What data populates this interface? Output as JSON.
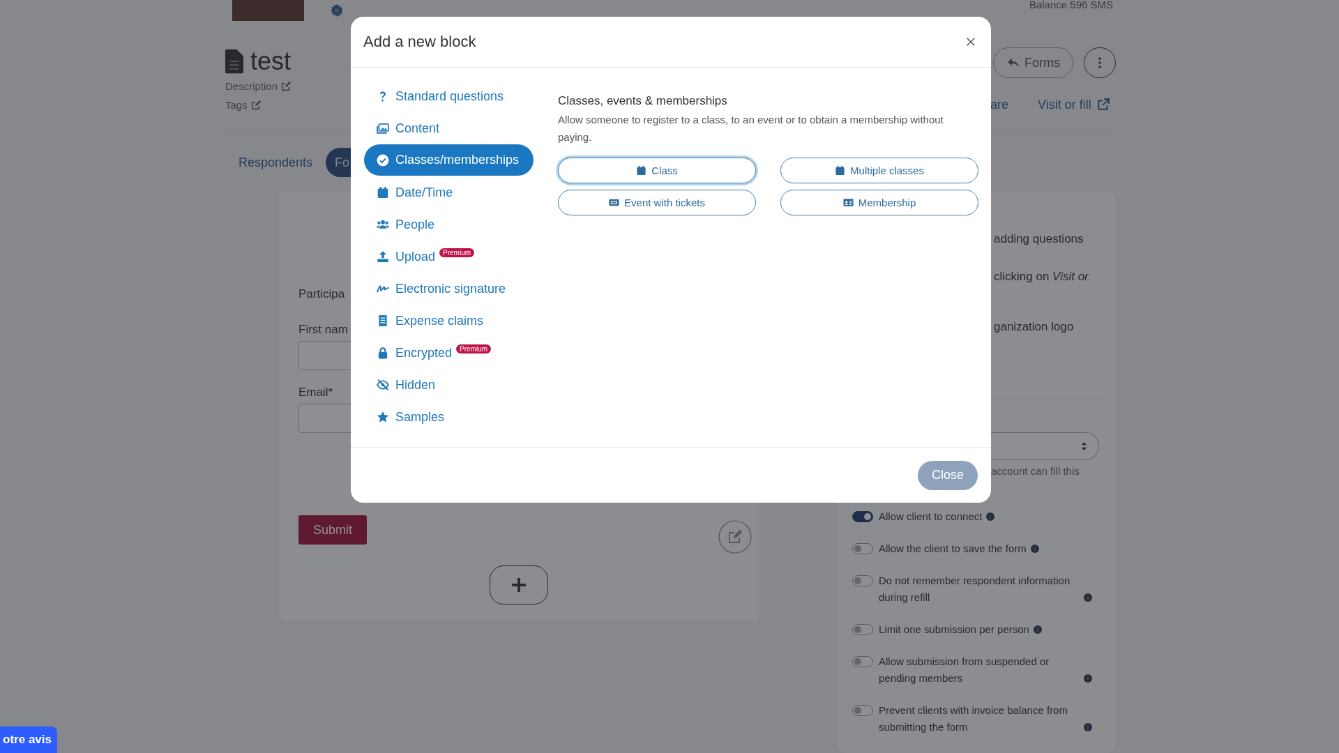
{
  "header": {
    "balance": "Balance 596 SMS",
    "title": "test",
    "links": [
      "Description",
      "Tags"
    ],
    "forms_button": "Forms",
    "share_link": "are",
    "visit_link": "Visit or fill"
  },
  "tabs": [
    {
      "label": "Respondents",
      "selected": false
    },
    {
      "label": "Fo",
      "selected": true
    }
  ],
  "form_preview": {
    "heading": "Participa",
    "fields": [
      {
        "label": "First nam"
      },
      {
        "label": "Email*"
      }
    ],
    "submit": "Submit"
  },
  "settings": {
    "notes": [
      "adding questions",
      "clicking on *Visit or*",
      "ganization logo"
    ],
    "select_hint": "account can fill this",
    "toggles": [
      {
        "label": "Allow client to connect",
        "on": true
      },
      {
        "label": "Allow the client to save the form",
        "on": false
      },
      {
        "label": "Do not remember respondent information during refill",
        "on": false
      },
      {
        "label": "Limit one submission per person",
        "on": false
      },
      {
        "label": "Allow submission from suspended or pending members",
        "on": false
      },
      {
        "label": "Prevent clients with invoice balance from submitting the form",
        "on": false
      }
    ]
  },
  "feedback_button": "otre avis",
  "modal": {
    "title": "Add a new block",
    "categories": [
      {
        "label": "Standard questions",
        "selected": false
      },
      {
        "label": "Content",
        "selected": false
      },
      {
        "label": "Classes/memberships",
        "selected": true
      },
      {
        "label": "Date/Time",
        "selected": false
      },
      {
        "label": "People",
        "selected": false
      },
      {
        "label": "Upload",
        "selected": false,
        "badge": "Premium"
      },
      {
        "label": "Electronic signature",
        "selected": false
      },
      {
        "label": "Expense claims",
        "selected": false
      },
      {
        "label": "Encrypted",
        "selected": false,
        "badge": "Premium"
      },
      {
        "label": "Hidden",
        "selected": false
      },
      {
        "label": "Samples",
        "selected": false
      }
    ],
    "section_title": "Classes, events & memberships",
    "section_description": "Allow someone to register to a class, to an event or to obtain a membership without paying.",
    "options": [
      {
        "label": "Class",
        "focused": true
      },
      {
        "label": "Multiple classes",
        "focused": false
      },
      {
        "label": "Event with tickets",
        "focused": false
      },
      {
        "label": "Membership",
        "focused": false
      }
    ],
    "close_button": "Close"
  }
}
